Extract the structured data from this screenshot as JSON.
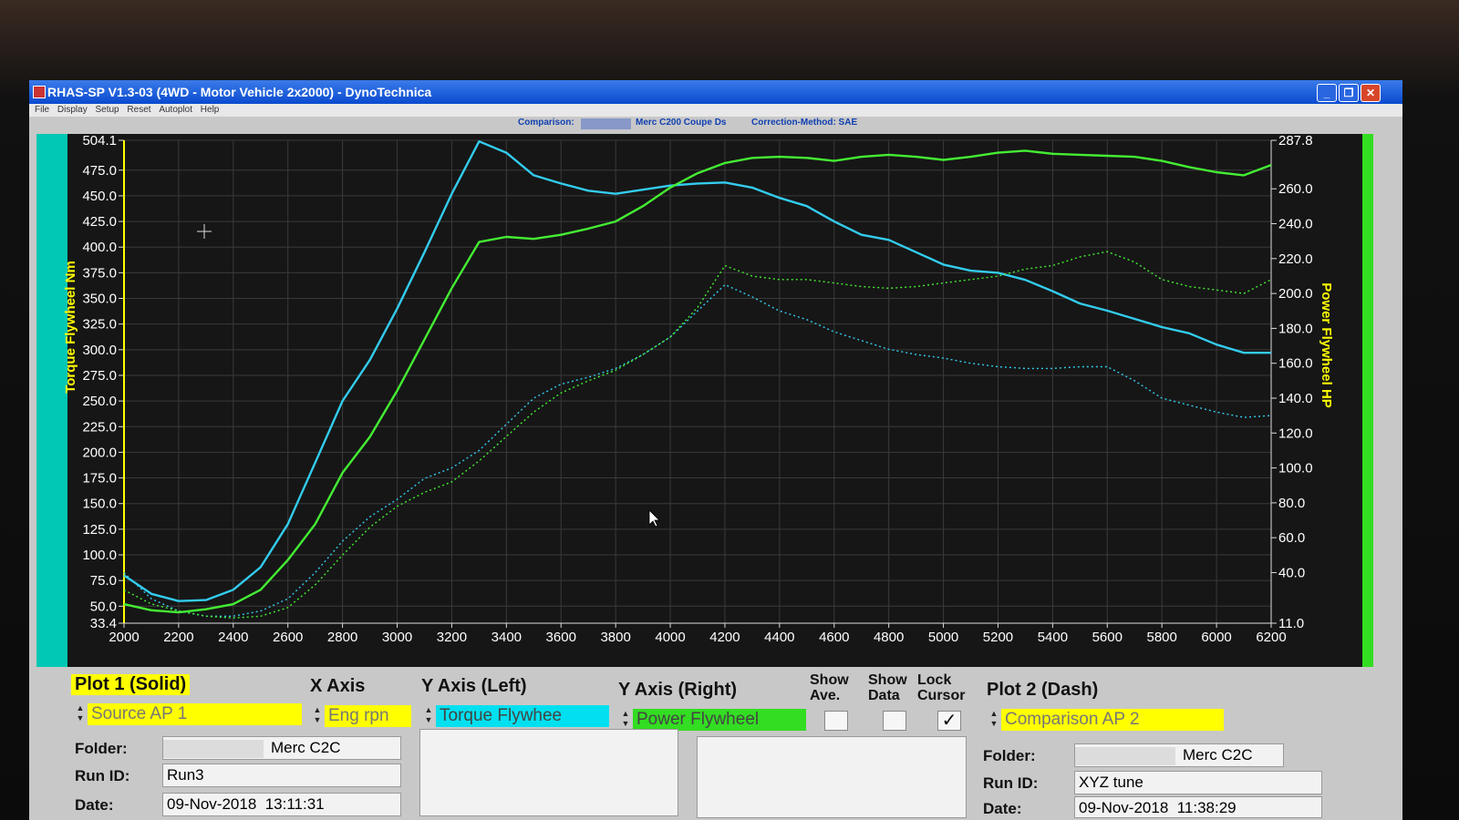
{
  "window": {
    "title": "RHAS-SP V1.3-03  (4WD - Motor Vehicle 2x2000) - DynoTechnica"
  },
  "menu": [
    "File",
    "Display",
    "Setup",
    "Reset",
    "Autoplot",
    "Help"
  ],
  "infobar": {
    "comparison_label": "Comparison:",
    "vehicle": "Merc C200 Coupe Ds",
    "correction": "Correction-Method: SAE"
  },
  "colors": {
    "accent": "#0a4ad0",
    "torque": "#33ccee",
    "power": "#44ee33",
    "yellow": "#ffff00"
  },
  "icons": {
    "cursor": "crosshair-icon",
    "pointer": "mouse-pointer-icon",
    "check": "checkmark-icon"
  },
  "chart_data": {
    "type": "line",
    "xlabel": "",
    "ylabel_left": "Torque Flywheel Nm",
    "ylabel_right": "Power Flywheel HP",
    "xlim": [
      2000,
      6200
    ],
    "ylim_left": [
      33.4,
      504.1
    ],
    "ylim_right": [
      11.0,
      287.8
    ],
    "grid": true,
    "x_ticks": [
      "2000",
      "2200",
      "2400",
      "2600",
      "2800",
      "3000",
      "3200",
      "3400",
      "3600",
      "3800",
      "4000",
      "4200",
      "4400",
      "4600",
      "4800",
      "5000",
      "5200",
      "5400",
      "5600",
      "5800",
      "6000",
      "6200"
    ],
    "y_left_ticks": [
      "504.1",
      "475.0",
      "450.0",
      "425.0",
      "400.0",
      "375.0",
      "350.0",
      "325.0",
      "300.0",
      "275.0",
      "250.0",
      "225.0",
      "200.0",
      "175.0",
      "150.0",
      "125.0",
      "100.0",
      "75.0",
      "50.0",
      "33.4"
    ],
    "y_right_ticks": [
      "287.8",
      "260.0",
      "240.0",
      "220.0",
      "200.0",
      "180.0",
      "160.0",
      "140.0",
      "120.0",
      "100.0",
      "80.0",
      "60.0",
      "40.0",
      "11.0"
    ],
    "series": [
      {
        "plot": "1",
        "style": "solid",
        "color": "#33ccee",
        "axis": "left",
        "x": [
          2000,
          2100,
          2200,
          2300,
          2400,
          2500,
          2600,
          2700,
          2800,
          2900,
          3000,
          3100,
          3200,
          3300,
          3400,
          3500,
          3600,
          3700,
          3800,
          3900,
          4000,
          4100,
          4200,
          4300,
          4400,
          4500,
          4600,
          4700,
          4800,
          4900,
          5000,
          5100,
          5200,
          5300,
          5400,
          5500,
          5600,
          5700,
          5800,
          5900,
          6000,
          6100,
          6200
        ],
        "y": [
          80,
          62,
          55,
          56,
          66,
          88,
          130,
          190,
          250,
          290,
          340,
          395,
          452,
          503,
          492,
          470,
          462,
          455,
          452,
          456,
          460,
          462,
          463,
          458,
          448,
          440,
          425,
          412,
          407,
          395,
          383,
          377,
          375,
          368,
          357,
          345,
          338,
          330,
          322,
          316,
          305,
          297,
          297
        ]
      },
      {
        "plot": "1",
        "style": "solid",
        "color": "#44ee33",
        "axis": "left",
        "x": [
          2000,
          2100,
          2200,
          2300,
          2400,
          2500,
          2600,
          2700,
          2800,
          2900,
          3000,
          3100,
          3200,
          3300,
          3400,
          3500,
          3600,
          3700,
          3800,
          3900,
          4000,
          4100,
          4200,
          4300,
          4400,
          4500,
          4600,
          4700,
          4800,
          4900,
          5000,
          5100,
          5200,
          5300,
          5400,
          5500,
          5600,
          5700,
          5800,
          5900,
          6000,
          6100,
          6200
        ],
        "y": [
          52,
          46,
          44,
          47,
          52,
          66,
          95,
          130,
          180,
          215,
          260,
          310,
          360,
          405,
          410,
          408,
          412,
          418,
          425,
          440,
          458,
          472,
          482,
          487,
          488,
          487,
          484,
          488,
          490,
          488,
          485,
          488,
          492,
          494,
          491,
          490,
          489,
          488,
          484,
          478,
          473,
          470,
          480
        ]
      },
      {
        "plot": "2",
        "style": "dash",
        "color": "#33ccee",
        "axis": "right",
        "x": [
          2000,
          2100,
          2200,
          2300,
          2400,
          2500,
          2600,
          2700,
          2800,
          2900,
          3000,
          3100,
          3200,
          3300,
          3400,
          3500,
          3600,
          3700,
          3800,
          3900,
          4000,
          4100,
          4200,
          4300,
          4400,
          4500,
          4600,
          4700,
          4800,
          4900,
          5000,
          5100,
          5200,
          5300,
          5400,
          5500,
          5600,
          5700,
          5800,
          5900,
          6000,
          6100,
          6200
        ],
        "y": [
          40,
          25,
          18,
          15,
          15,
          18,
          25,
          40,
          58,
          72,
          82,
          94,
          100,
          110,
          125,
          140,
          148,
          152,
          157,
          165,
          175,
          190,
          205,
          198,
          190,
          185,
          178,
          173,
          168,
          165,
          163,
          160,
          158,
          157,
          157,
          158,
          158,
          150,
          140,
          136,
          132,
          129,
          130
        ]
      },
      {
        "plot": "2",
        "style": "dash",
        "color": "#44ee33",
        "axis": "right",
        "x": [
          2000,
          2100,
          2200,
          2300,
          2400,
          2500,
          2600,
          2700,
          2800,
          2900,
          3000,
          3100,
          3200,
          3300,
          3400,
          3500,
          3600,
          3700,
          3800,
          3900,
          4000,
          4100,
          4200,
          4300,
          4400,
          4500,
          4600,
          4700,
          4800,
          4900,
          5000,
          5100,
          5200,
          5300,
          5400,
          5500,
          5600,
          5700,
          5800,
          5900,
          6000,
          6100,
          6200
        ],
        "y": [
          30,
          22,
          18,
          15,
          14,
          15,
          20,
          33,
          50,
          66,
          78,
          86,
          92,
          104,
          118,
          132,
          143,
          150,
          156,
          165,
          175,
          192,
          216,
          210,
          208,
          208,
          206,
          204,
          203,
          204,
          206,
          208,
          210,
          214,
          216,
          221,
          224,
          218,
          208,
          204,
          202,
          200,
          208
        ]
      }
    ]
  },
  "plot1": {
    "heading": "Plot 1 (Solid)",
    "source": "Source AP 1",
    "folder_label": "Folder:",
    "folder_value": "Merc C2C",
    "runid_label": "Run ID:",
    "runid_value": "Run3",
    "date_label": "Date:",
    "date_value": "09-Nov-2018  13:11:31"
  },
  "xaxis": {
    "heading": "X Axis",
    "value": "Eng rpn"
  },
  "yleft": {
    "heading": "Y Axis (Left)",
    "value": "Torque Flywhee"
  },
  "yright": {
    "heading": "Y Axis (Right)",
    "value": "Power Flywheel"
  },
  "checks": {
    "show_ave_line1": "Show",
    "show_ave_line2": "Ave.",
    "show_data_line1": "Show",
    "show_data_line2": "Data",
    "lock_cursor_line1": "Lock",
    "lock_cursor_line2": "Cursor",
    "lock_cursor_mark": "✓"
  },
  "plot2": {
    "heading": "Plot 2 (Dash)",
    "source": "Comparison AP 2",
    "folder_label": "Folder:",
    "folder_value": "Merc C2C",
    "runid_label": "Run ID:",
    "runid_value": "XYZ tune",
    "date_label": "Date:",
    "date_value": "09-Nov-2018  11:38:29"
  }
}
